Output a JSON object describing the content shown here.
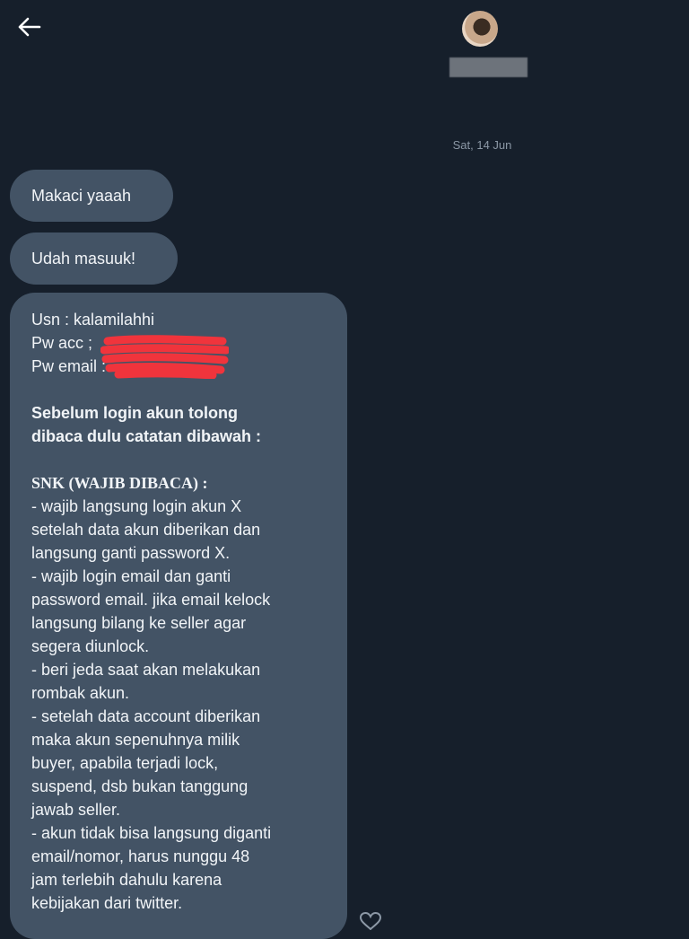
{
  "header": {
    "back_icon": "arrow-left-icon",
    "avatar_icon": "avatar"
  },
  "date_separator": "Sat, 14 Jun",
  "messages": [
    {
      "text": "Makaci yaaah"
    },
    {
      "text": "Udah masuuk!"
    }
  ],
  "long_message": {
    "credentials": [
      "Usn : kalamilahhi",
      "Pw acc ; ",
      "Pw email : "
    ],
    "intro": [
      "Sebelum login akun tolong",
      "dibaca dulu catatan dibawah :"
    ],
    "snk_title": "SNK (WAJIB DIBACA) :",
    "snk_lines": [
      "- wajib langsung login akun X",
      "setelah data akun diberikan dan",
      "langsung ganti password X.",
      "- wajib login email dan ganti",
      "password email. jika email kelock",
      "langsung bilang ke seller agar",
      "segera diunlock.",
      "- beri jeda saat akan melakukan",
      "rombak akun.",
      "- setelah data account diberikan",
      "maka akun sepenuhnya milik",
      "buyer, apabila terjadi lock,",
      "suspend, dsb bukan tanggung",
      "jawab seller.",
      "- akun tidak bisa langsung diganti",
      "email/nomor, harus nunggu 48",
      "jam terlebih dahulu karena",
      "kebijakan dari twitter."
    ]
  },
  "colors": {
    "background": "#161f2b",
    "bubble": "#435365",
    "redaction": "#f0343c"
  },
  "reaction_icon": "heart-icon"
}
